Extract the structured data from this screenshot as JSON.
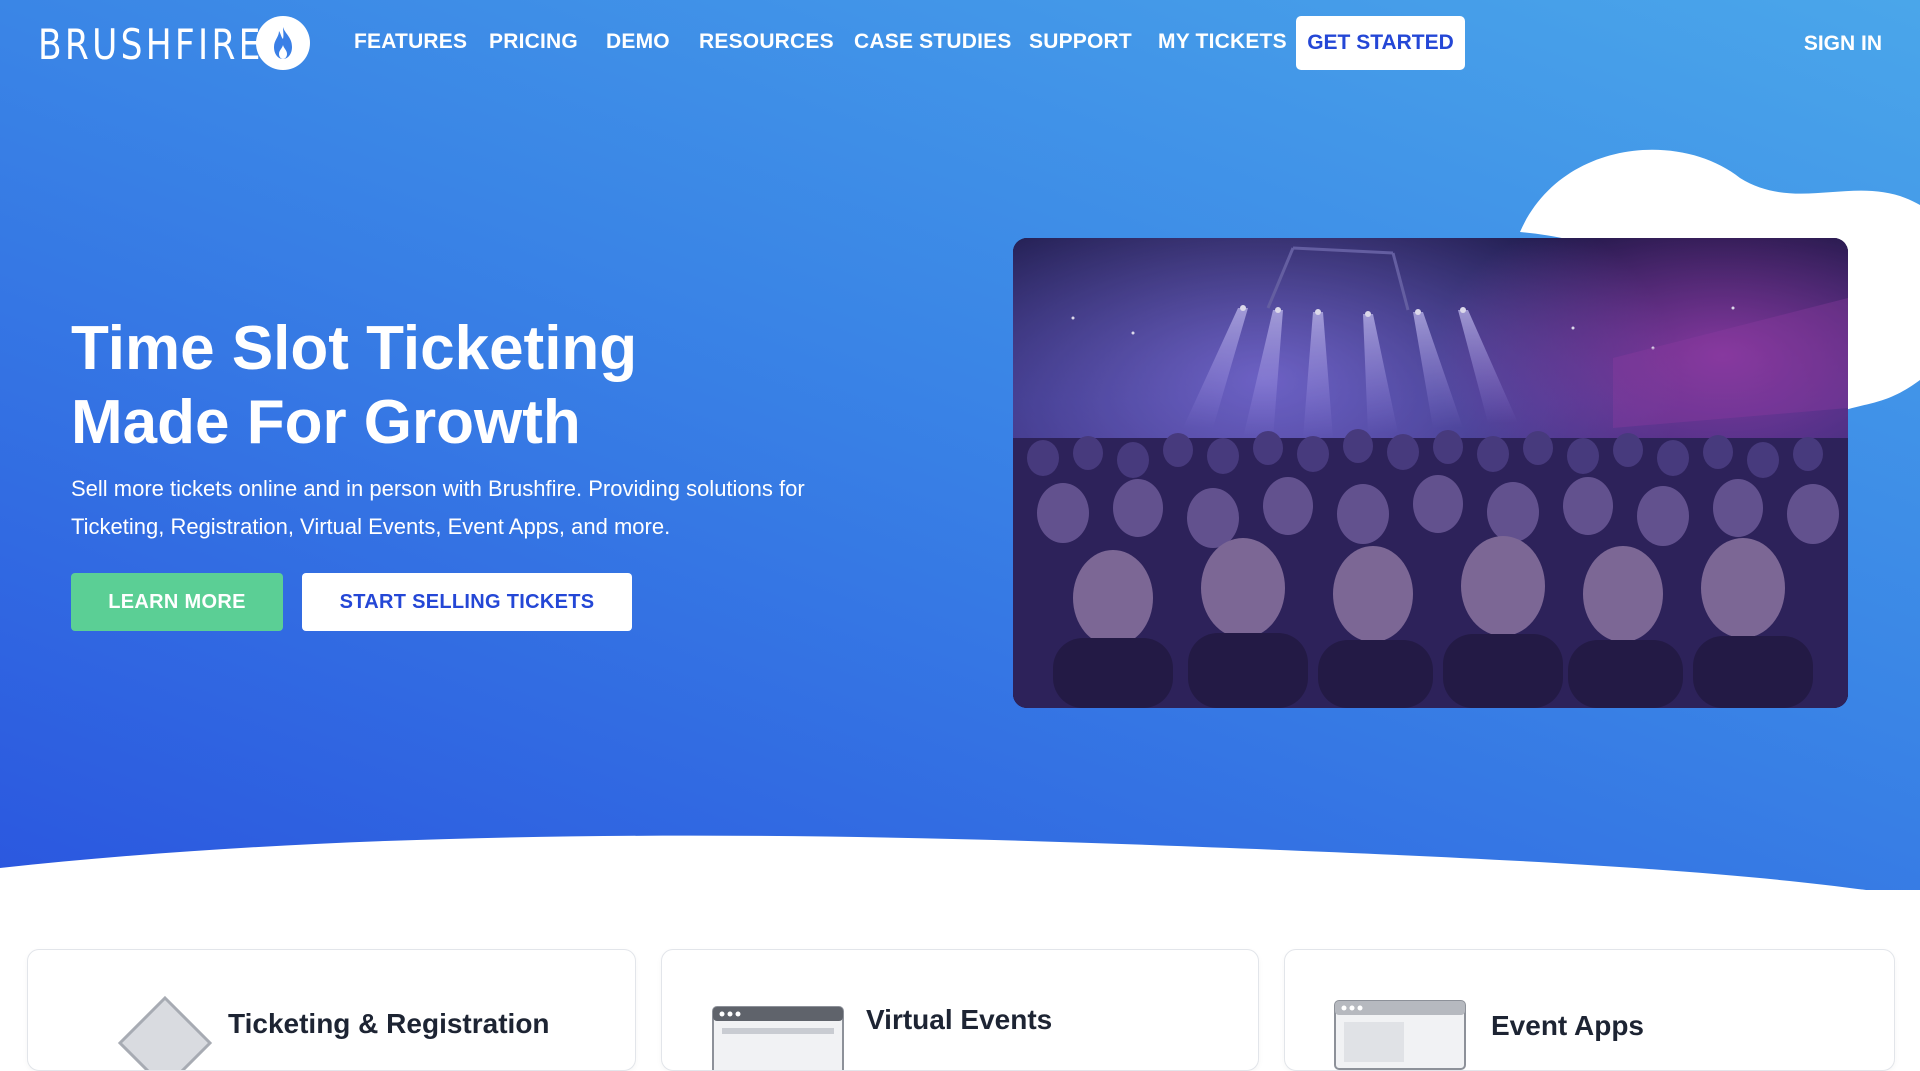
{
  "brand": {
    "name": "BRUSHFIRE",
    "logo_icon": "flame-icon"
  },
  "nav": {
    "items": [
      {
        "label": "FEATURES"
      },
      {
        "label": "PRICING"
      },
      {
        "label": "DEMO"
      },
      {
        "label": "RESOURCES"
      },
      {
        "label": "CASE STUDIES"
      },
      {
        "label": "SUPPORT"
      },
      {
        "label": "MY TICKETS"
      }
    ],
    "cta_label": "GET STARTED",
    "signin_label": "SIGN IN"
  },
  "hero": {
    "title_line1": "Time Slot Ticketing",
    "title_line2": "Made For Growth",
    "subtitle_line1": "Sell more tickets online and in person with Brushfire. Providing solutions for",
    "subtitle_line2": "Ticketing, Registration, Virtual Events, Event Apps, and more.",
    "learn_more_label": "LEARN MORE",
    "start_selling_label": "START SELLING TICKETS",
    "video_subject": "concert-crowd-video"
  },
  "cards": [
    {
      "title": "Ticketing & Registration",
      "icon": "ticket-icon"
    },
    {
      "title": "Virtual Events",
      "icon": "browser-window-icon"
    },
    {
      "title": "Event Apps",
      "icon": "browser-window-icon"
    }
  ],
  "colors": {
    "hero_gradient_start": "#4aa6ea",
    "hero_gradient_end": "#2b57df",
    "brand_blue": "#2447d6",
    "accent_green": "#5bcf95",
    "white": "#ffffff"
  }
}
